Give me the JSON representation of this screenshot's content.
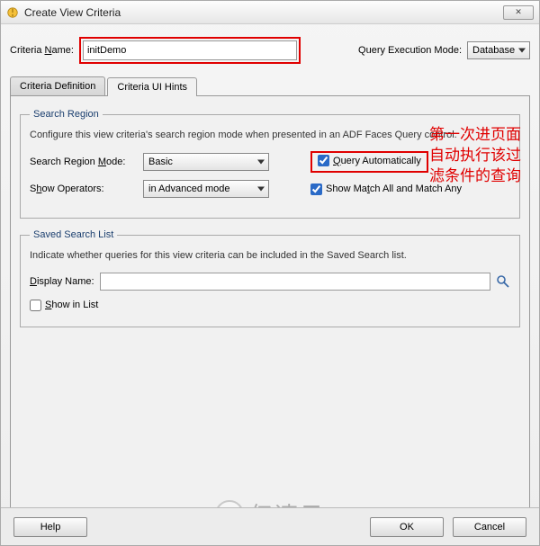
{
  "window": {
    "title": "Create View Criteria",
    "close_glyph": "✕"
  },
  "top": {
    "criteria_name_label": "Criteria Name:",
    "criteria_name_value": "initDemo",
    "query_mode_label": "Query Execution Mode:",
    "query_mode_value": "Database"
  },
  "tabs": {
    "definition": "Criteria Definition",
    "uihints": "Criteria UI Hints"
  },
  "search_region": {
    "legend": "Search Region",
    "desc": "Configure this view criteria's search region mode when presented in an ADF Faces Query control.",
    "mode_label": "Search Region Mode:",
    "mode_value": "Basic",
    "query_auto_label": "Query Automatically",
    "query_auto_checked": true,
    "show_operators_label": "Show Operators:",
    "show_operators_value": "in Advanced mode",
    "show_match_label": "Show Match All and Match Any",
    "show_match_checked": true
  },
  "saved": {
    "legend": "Saved Search List",
    "desc": "Indicate whether queries for this view criteria can be included in the Saved Search list.",
    "display_name_label": "Display Name:",
    "display_name_value": "",
    "show_in_list_label": "Show in List",
    "show_in_list_checked": false
  },
  "annotation": "第一次进页面自动执行该过滤条件的查询",
  "buttons": {
    "help": "Help",
    "ok": "OK",
    "cancel": "Cancel"
  },
  "watermark": "亿速云"
}
